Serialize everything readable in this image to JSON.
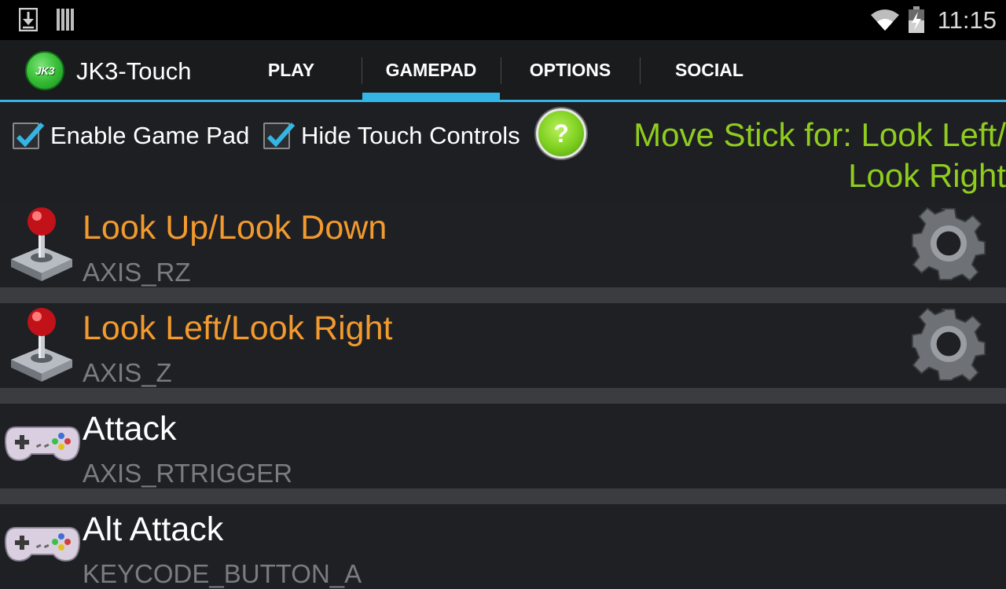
{
  "status_bar": {
    "time": "11:15",
    "left_icons": [
      "download-icon",
      "barcode-icon"
    ],
    "right_icons": [
      "wifi-icon",
      "battery-icon"
    ]
  },
  "action_bar": {
    "logo_text": "JK3",
    "app_title": "JK3-Touch",
    "tabs": [
      {
        "label": "PLAY",
        "selected": false
      },
      {
        "label": "GAMEPAD",
        "selected": true
      },
      {
        "label": "OPTIONS",
        "selected": false
      },
      {
        "label": "SOCIAL",
        "selected": false
      }
    ],
    "accent_color": "#33b5e5"
  },
  "options": {
    "enable_game_pad": {
      "label": "Enable Game Pad",
      "checked": true
    },
    "hide_touch_controls": {
      "label": "Hide Touch Controls",
      "checked": true
    },
    "help_symbol": "?",
    "move_stick_line1": "Move Stick for: Look Left/",
    "move_stick_line2": "Look Right"
  },
  "list": {
    "items": [
      {
        "title": "Look Up/Look Down",
        "subtitle": "AXIS_RZ",
        "icon": "joystick-icon",
        "analog": true
      },
      {
        "title": "Look Left/Look Right",
        "subtitle": "AXIS_Z",
        "icon": "joystick-icon",
        "analog": true
      },
      {
        "title": "Attack",
        "subtitle": "AXIS_RTRIGGER",
        "icon": "gamepad-icon",
        "analog": false
      },
      {
        "title": "Alt Attack",
        "subtitle": "KEYCODE_BUTTON_A",
        "icon": "gamepad-icon",
        "analog": false
      }
    ]
  }
}
